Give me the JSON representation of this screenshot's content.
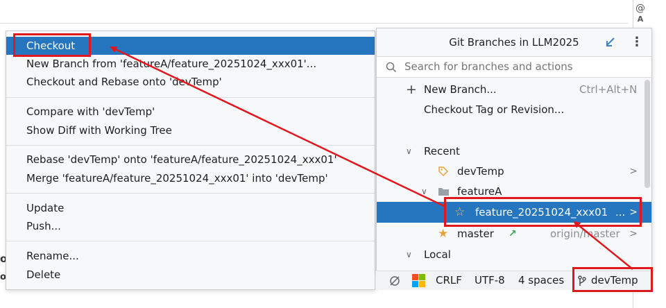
{
  "editor": {
    "snippet_top": "@",
    "snippet_second": "A",
    "left_clip_1": "o",
    "left_clip_2": "ol"
  },
  "context_menu": {
    "items": [
      {
        "label": "Checkout"
      },
      {
        "label": "New Branch from 'featureA/feature_20251024_xxx01'..."
      },
      {
        "label": "Checkout and Rebase onto 'devTemp'"
      },
      {
        "label": "Compare with 'devTemp'"
      },
      {
        "label": "Show Diff with Working Tree"
      },
      {
        "label": "Rebase 'devTemp' onto 'featureA/feature_20251024_xxx01'"
      },
      {
        "label": "Merge 'featureA/feature_20251024_xxx01' into 'devTemp'"
      },
      {
        "label": "Update"
      },
      {
        "label": "Push..."
      },
      {
        "label": "Rename..."
      },
      {
        "label": "Delete"
      }
    ]
  },
  "branches_popup": {
    "title": "Git Branches in LLM2025",
    "search_placeholder": "Search for branches and actions",
    "new_branch": {
      "label": "New Branch...",
      "shortcut": "Ctrl+Alt+N"
    },
    "checkout_tag": {
      "label": "Checkout Tag or Revision..."
    },
    "recent": {
      "label": "Recent"
    },
    "devtemp": {
      "label": "devTemp"
    },
    "featureA": {
      "label": "featureA"
    },
    "feature_branch": {
      "label": "feature_20251024_xxx01",
      "ellipsis": "..."
    },
    "master": {
      "label": "master",
      "tracking": "origin/master"
    },
    "local": {
      "label": "Local"
    },
    "chevron": ">"
  },
  "status_bar": {
    "line_separator": "CRLF",
    "encoding": "UTF-8",
    "indent": "4 spaces",
    "branch": "devTemp"
  },
  "colors": {
    "selection": "#2675bf",
    "annotation_red": "#e0181e",
    "tag_orange": "#e8a33c",
    "star_gold": "#e8a33c"
  }
}
